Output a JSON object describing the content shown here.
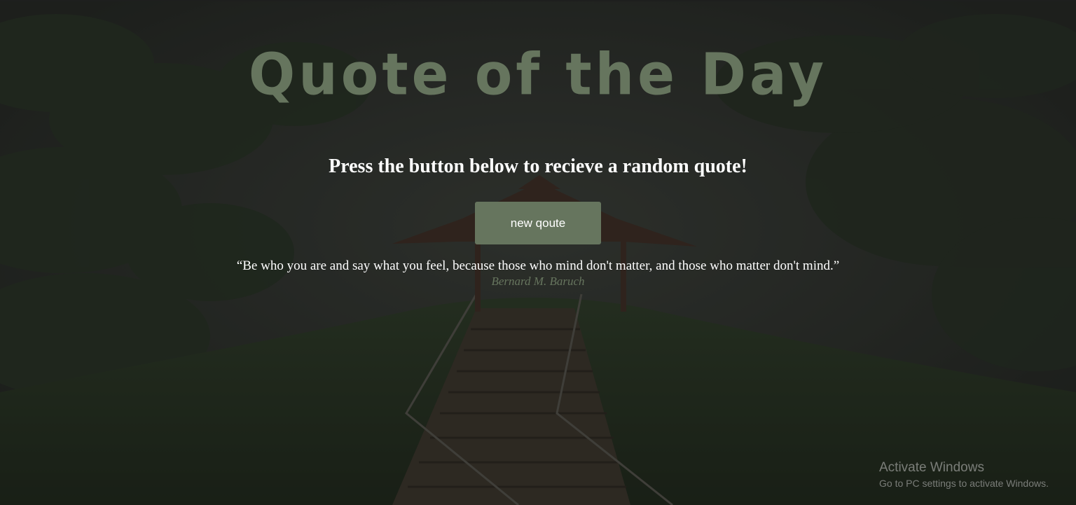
{
  "page": {
    "title": "Quote of the Day",
    "subtitle": "Press the button below to recieve a random quote!",
    "button_label": "new qoute",
    "quote_text": "“Be who you are and say what you feel, because those who mind don't matter, and those who matter don't mind.”",
    "quote_author": "Bernard M. Baruch"
  },
  "watermark": {
    "title": "Activate Windows",
    "subtitle": "Go to PC settings to activate Windows."
  },
  "colors": {
    "accent": "#66755e",
    "text": "#ffffff",
    "background": "#2a2c28"
  },
  "background_image": {
    "icon": "forest-stairs-pavilion-scene"
  }
}
